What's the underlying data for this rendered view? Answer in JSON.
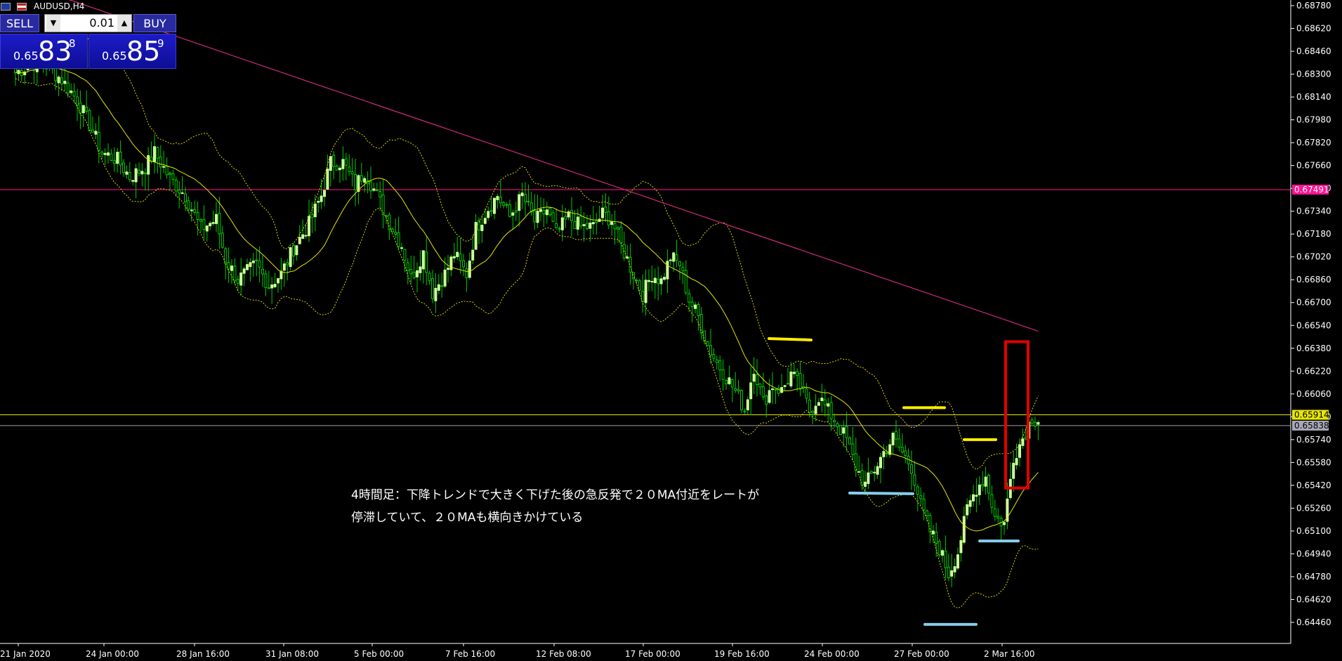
{
  "symbol": "AUDUSD,H4",
  "panel": {
    "sell_label": "SELL",
    "buy_label": "BUY",
    "lot": "0.01",
    "bid_prefix": "0.65",
    "bid_big": "83",
    "bid_sup": "8",
    "ask_prefix": "0.65",
    "ask_big": "85",
    "ask_sup": "9"
  },
  "colors": {
    "background": "#000000",
    "bull_candle": "#ccff99",
    "bear_candle": "#00cc00",
    "ma20": "#e6e600",
    "bollinger": "#d9d900",
    "ma_long": "#cc2a7a",
    "marker_yellow": "#ffee00",
    "marker_blue": "#87ceeb",
    "rect": "#e00000",
    "axis_text": "#ffffff"
  },
  "annotation": {
    "line1": "4時間足：下降トレンドで大きく下げた後の急反発で２０MA付近をレートが",
    "line2": "停滞していて、２０MAも横向きかけている"
  },
  "chart_data": {
    "type": "candlestick",
    "price_axis_ticks": [
      "0.68780",
      "0.68620",
      "0.68460",
      "0.68300",
      "0.68140",
      "0.67980",
      "0.67820",
      "0.67660",
      "0.67500",
      "0.67340",
      "0.67180",
      "0.67020",
      "0.66860",
      "0.66700",
      "0.66540",
      "0.66380",
      "0.66220",
      "0.66060",
      "0.65900",
      "0.65740",
      "0.65580",
      "0.65420",
      "0.65260",
      "0.65100",
      "0.64940",
      "0.64780",
      "0.64620",
      "0.64460"
    ],
    "time_axis_labels": [
      "21 Jan 2020",
      "24 Jan 00:00",
      "28 Jan 16:00",
      "31 Jan 08:00",
      "5 Feb 00:00",
      "7 Feb 16:00",
      "12 Feb 08:00",
      "17 Feb 00:00",
      "19 Feb 16:00",
      "24 Feb 00:00",
      "27 Feb 00:00",
      "2 Mar 16:00"
    ],
    "ylim": [
      0.6436,
      0.6881
    ],
    "horizontal_lines": [
      {
        "label": "0.67491",
        "price": 0.67491,
        "color": "#ff1493"
      },
      {
        "label": "0.65914",
        "price": 0.65914,
        "color": "#e6e600"
      },
      {
        "label": "0.65838",
        "price": 0.65838,
        "color": "#a0a0a0"
      }
    ],
    "close_path": [
      [
        0,
        0.6831
      ],
      [
        8,
        0.684
      ],
      [
        15,
        0.6826
      ],
      [
        20,
        0.6812
      ],
      [
        25,
        0.679
      ],
      [
        28,
        0.6775
      ],
      [
        33,
        0.677
      ],
      [
        37,
        0.6758
      ],
      [
        42,
        0.6765
      ],
      [
        45,
        0.6775
      ],
      [
        50,
        0.6757
      ],
      [
        55,
        0.6745
      ],
      [
        60,
        0.6722
      ],
      [
        65,
        0.6728
      ],
      [
        68,
        0.67
      ],
      [
        72,
        0.6686
      ],
      [
        78,
        0.6697
      ],
      [
        82,
        0.6682
      ],
      [
        86,
        0.669
      ],
      [
        90,
        0.6708
      ],
      [
        95,
        0.6725
      ],
      [
        99,
        0.6745
      ],
      [
        102,
        0.6768
      ],
      [
        106,
        0.6768
      ],
      [
        110,
        0.6752
      ],
      [
        113,
        0.6762
      ],
      [
        117,
        0.6745
      ],
      [
        121,
        0.6726
      ],
      [
        125,
        0.671
      ],
      [
        128,
        0.6687
      ],
      [
        132,
        0.6705
      ],
      [
        135,
        0.6677
      ],
      [
        139,
        0.669
      ],
      [
        142,
        0.6704
      ],
      [
        146,
        0.669
      ],
      [
        149,
        0.6722
      ],
      [
        153,
        0.6736
      ],
      [
        156,
        0.6745
      ],
      [
        160,
        0.673
      ],
      [
        164,
        0.6745
      ],
      [
        168,
        0.6727
      ],
      [
        172,
        0.6735
      ],
      [
        175,
        0.6718
      ],
      [
        179,
        0.673
      ],
      [
        183,
        0.6723
      ],
      [
        187,
        0.6723
      ],
      [
        190,
        0.6732
      ],
      [
        193,
        0.6728
      ],
      [
        196,
        0.671
      ],
      [
        200,
        0.669
      ],
      [
        203,
        0.6676
      ],
      [
        206,
        0.669
      ],
      [
        209,
        0.6685
      ],
      [
        212,
        0.6702
      ],
      [
        215,
        0.6697
      ],
      [
        218,
        0.6672
      ],
      [
        221,
        0.666
      ],
      [
        224,
        0.664
      ],
      [
        227,
        0.6628
      ],
      [
        230,
        0.6618
      ],
      [
        233,
        0.6608
      ],
      [
        236,
        0.6595
      ],
      [
        239,
        0.6625
      ],
      [
        242,
        0.66
      ],
      [
        245,
        0.6612
      ],
      [
        248,
        0.6608
      ],
      [
        251,
        0.662
      ],
      [
        254,
        0.6611
      ],
      [
        257,
        0.6594
      ],
      [
        260,
        0.6604
      ],
      [
        263,
        0.6594
      ],
      [
        266,
        0.6585
      ],
      [
        269,
        0.6574
      ],
      [
        272,
        0.6555
      ],
      [
        275,
        0.6542
      ],
      [
        278,
        0.6553
      ],
      [
        281,
        0.6565
      ],
      [
        284,
        0.6575
      ],
      [
        287,
        0.6565
      ],
      [
        290,
        0.6555
      ],
      [
        293,
        0.6528
      ],
      [
        296,
        0.651
      ],
      [
        299,
        0.6498
      ],
      [
        302,
        0.648
      ],
      [
        305,
        0.6495
      ],
      [
        308,
        0.6525
      ],
      [
        311,
        0.654
      ],
      [
        314,
        0.6548
      ],
      [
        317,
        0.652
      ],
      [
        320,
        0.6515
      ],
      [
        323,
        0.6562
      ],
      [
        326,
        0.6575
      ],
      [
        329,
        0.659
      ],
      [
        331,
        0.6586
      ]
    ],
    "candle_count": 332,
    "markers": [
      {
        "color": "yellow",
        "price": 0.66448
      },
      {
        "color": "yellow",
        "price": 0.65964
      },
      {
        "color": "yellow",
        "price": 0.6574
      },
      {
        "color": "blue",
        "price": 0.65366
      },
      {
        "color": "blue",
        "price": 0.6503
      },
      {
        "color": "blue",
        "price": 0.64446
      }
    ],
    "rect_high": 0.66426,
    "rect_low": 0.65401
  }
}
